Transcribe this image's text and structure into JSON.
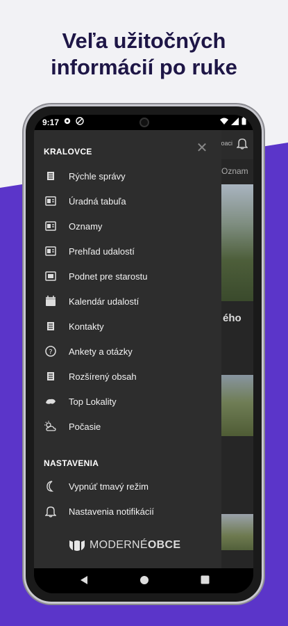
{
  "headline": {
    "line1": "Veľa užitočných",
    "line2": "informácií po ruke"
  },
  "status_bar": {
    "time": "9:17",
    "left_icons": [
      "gear-icon",
      "vpn-icon"
    ],
    "right_icons": [
      "wifi-icon",
      "signal-icon",
      "battery-icon"
    ]
  },
  "app_behind": {
    "header_text": "oaci",
    "tab_text": "Oznam",
    "card_title": "ého"
  },
  "drawer": {
    "section_main": "KRALOVCE",
    "items": [
      {
        "label": "Rýchle správy",
        "icon": "list-icon"
      },
      {
        "label": "Úradná tabuľa",
        "icon": "board-icon"
      },
      {
        "label": "Oznamy",
        "icon": "announcement-icon"
      },
      {
        "label": "Prehľad udalostí",
        "icon": "events-icon"
      },
      {
        "label": "Podnet pre starostu",
        "icon": "report-icon"
      },
      {
        "label": "Kalendár udalostí",
        "icon": "calendar-icon"
      },
      {
        "label": "Kontakty",
        "icon": "contacts-icon"
      },
      {
        "label": "Ankety a otázky",
        "icon": "question-icon"
      },
      {
        "label": "Rozšírený obsah",
        "icon": "content-icon"
      },
      {
        "label": "Top Lokality",
        "icon": "location-icon"
      },
      {
        "label": "Počasie",
        "icon": "weather-icon"
      }
    ],
    "section_settings": "NASTAVENIA",
    "settings_items": [
      {
        "label": "Vypnúť tmavý režim",
        "icon": "moon-icon"
      },
      {
        "label": "Nastavenia notifikácií",
        "icon": "bell-icon"
      }
    ],
    "logo": {
      "part1": "MODERNÉ",
      "part2": "OBCE"
    }
  },
  "colors": {
    "background": "#f2f2f5",
    "accent_purple": "#5b35c9",
    "headline": "#1e1646",
    "drawer": "#2d2d2d"
  }
}
